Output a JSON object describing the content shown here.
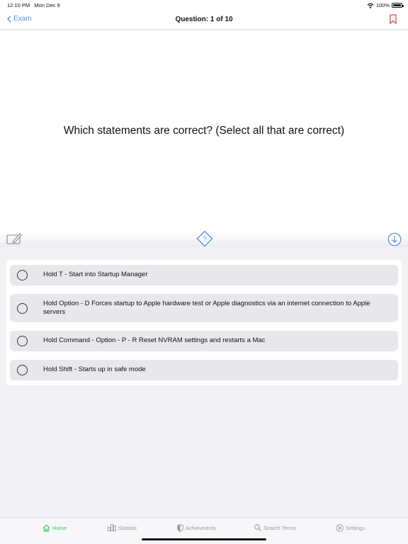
{
  "status": {
    "time": "12:10 PM",
    "date": "Mon Dec 9",
    "battery": "100%"
  },
  "nav": {
    "back_label": "Exam",
    "title": "Question: 1 of 10"
  },
  "question": {
    "text": "Which statements are correct? (Select all that are correct)"
  },
  "answers": [
    {
      "label": "Hold T - Start into Startup Manager",
      "selected": false
    },
    {
      "label": "Hold Option - D Forces startup to Apple hardware test or Apple diagnostics via an internet connection to Apple servers",
      "selected": false
    },
    {
      "label": "Hold Command - Option - P - R Reset NVRAM settings and restarts a Mac",
      "selected": false
    },
    {
      "label": "Hold Shift - Starts up in safe mode",
      "selected": false
    }
  ],
  "tabs": [
    {
      "label": "Home",
      "icon": "house-icon",
      "active": true
    },
    {
      "label": "Statistic",
      "icon": "bar-chart-icon",
      "active": false
    },
    {
      "label": "Achievments",
      "icon": "shield-icon",
      "active": false
    },
    {
      "label": "Search Terms",
      "icon": "search-icon",
      "active": false
    },
    {
      "label": "Settings",
      "icon": "play-circle-icon",
      "active": false
    }
  ],
  "colors": {
    "accent": "#4a90e2",
    "bookmark": "#e5484d",
    "active_tab": "#34c759"
  }
}
